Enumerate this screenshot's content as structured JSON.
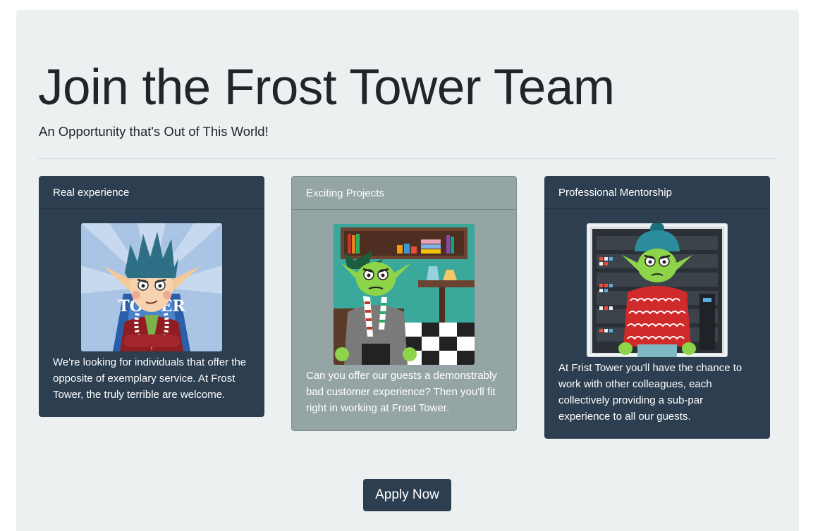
{
  "hero": {
    "title": "Join the Frost Tower Team",
    "subtitle": "An Opportunity that's Out of This World!"
  },
  "cards": [
    {
      "header": "Real experience",
      "text": "We're looking for individuals that offer the opposite of exemplary service. At Frost Tower, the truly terrible are welcome.",
      "image_lettering": "TOWER"
    },
    {
      "header": "Exciting Projects",
      "text": "Can you offer our guests a demonstrably bad customer experience? Then you'll fit right in working at Frost Tower."
    },
    {
      "header": "Professional Mentorship",
      "text": "At Frist Tower you'll have the chance to work with other colleagues, each collectively providing a sub-par experience to all our guests."
    }
  ],
  "apply_button": {
    "label": "Apply Now"
  },
  "colors": {
    "jumbotron_bg": "#ecf0f1",
    "card_dark": "#2c3e50",
    "card_grey": "#95a5a6",
    "text_dark": "#212529",
    "goblin_green": "#8ed44a"
  }
}
